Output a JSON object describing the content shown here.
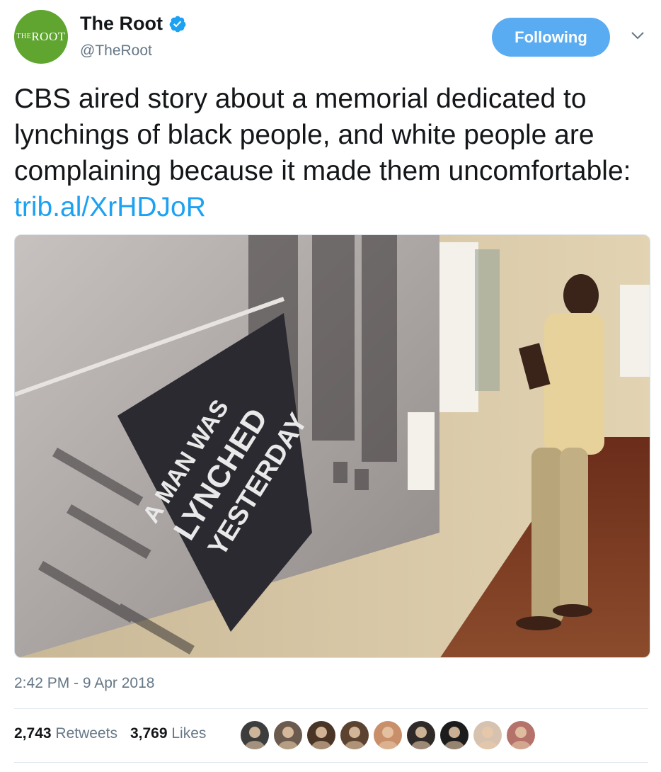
{
  "user": {
    "avatar_text_small": "THE",
    "avatar_text_big": "ROOT",
    "name": "The Root",
    "handle": "@TheRoot",
    "verified": true
  },
  "follow_button": {
    "label": "Following"
  },
  "tweet": {
    "text": "CBS aired story about a memorial dedicated to lynchings of black people, and white people are complaining because it made them uncomfortable: ",
    "link": "trib.al/XrHDJoR",
    "image_sign_text": [
      "A MAN WAS",
      "LYNCHED",
      "YESTERDAY"
    ],
    "timestamp": "2:42 PM - 9 Apr 2018"
  },
  "stats": {
    "retweets_count": "2,743",
    "retweets_label": "Retweets",
    "likes_count": "3,769",
    "likes_label": "Likes"
  },
  "colors": {
    "link": "#1da1f2",
    "follow_button": "#5aacf2",
    "verified": "#1da1f2",
    "avatar_bg": "#5fa52f"
  },
  "likers": [
    {
      "icon": "liker-avatar-1",
      "color": "#3d3d3d"
    },
    {
      "icon": "liker-avatar-2",
      "color": "#6b5a4e"
    },
    {
      "icon": "liker-avatar-3",
      "color": "#4a3426"
    },
    {
      "icon": "liker-avatar-4",
      "color": "#5b4330"
    },
    {
      "icon": "liker-avatar-5",
      "color": "#c98f6a"
    },
    {
      "icon": "liker-avatar-6",
      "color": "#2f2a28"
    },
    {
      "icon": "liker-avatar-7",
      "color": "#1c1c1c"
    },
    {
      "icon": "liker-avatar-8",
      "color": "#d7c2b0"
    },
    {
      "icon": "liker-avatar-9",
      "color": "#b4726a"
    }
  ]
}
